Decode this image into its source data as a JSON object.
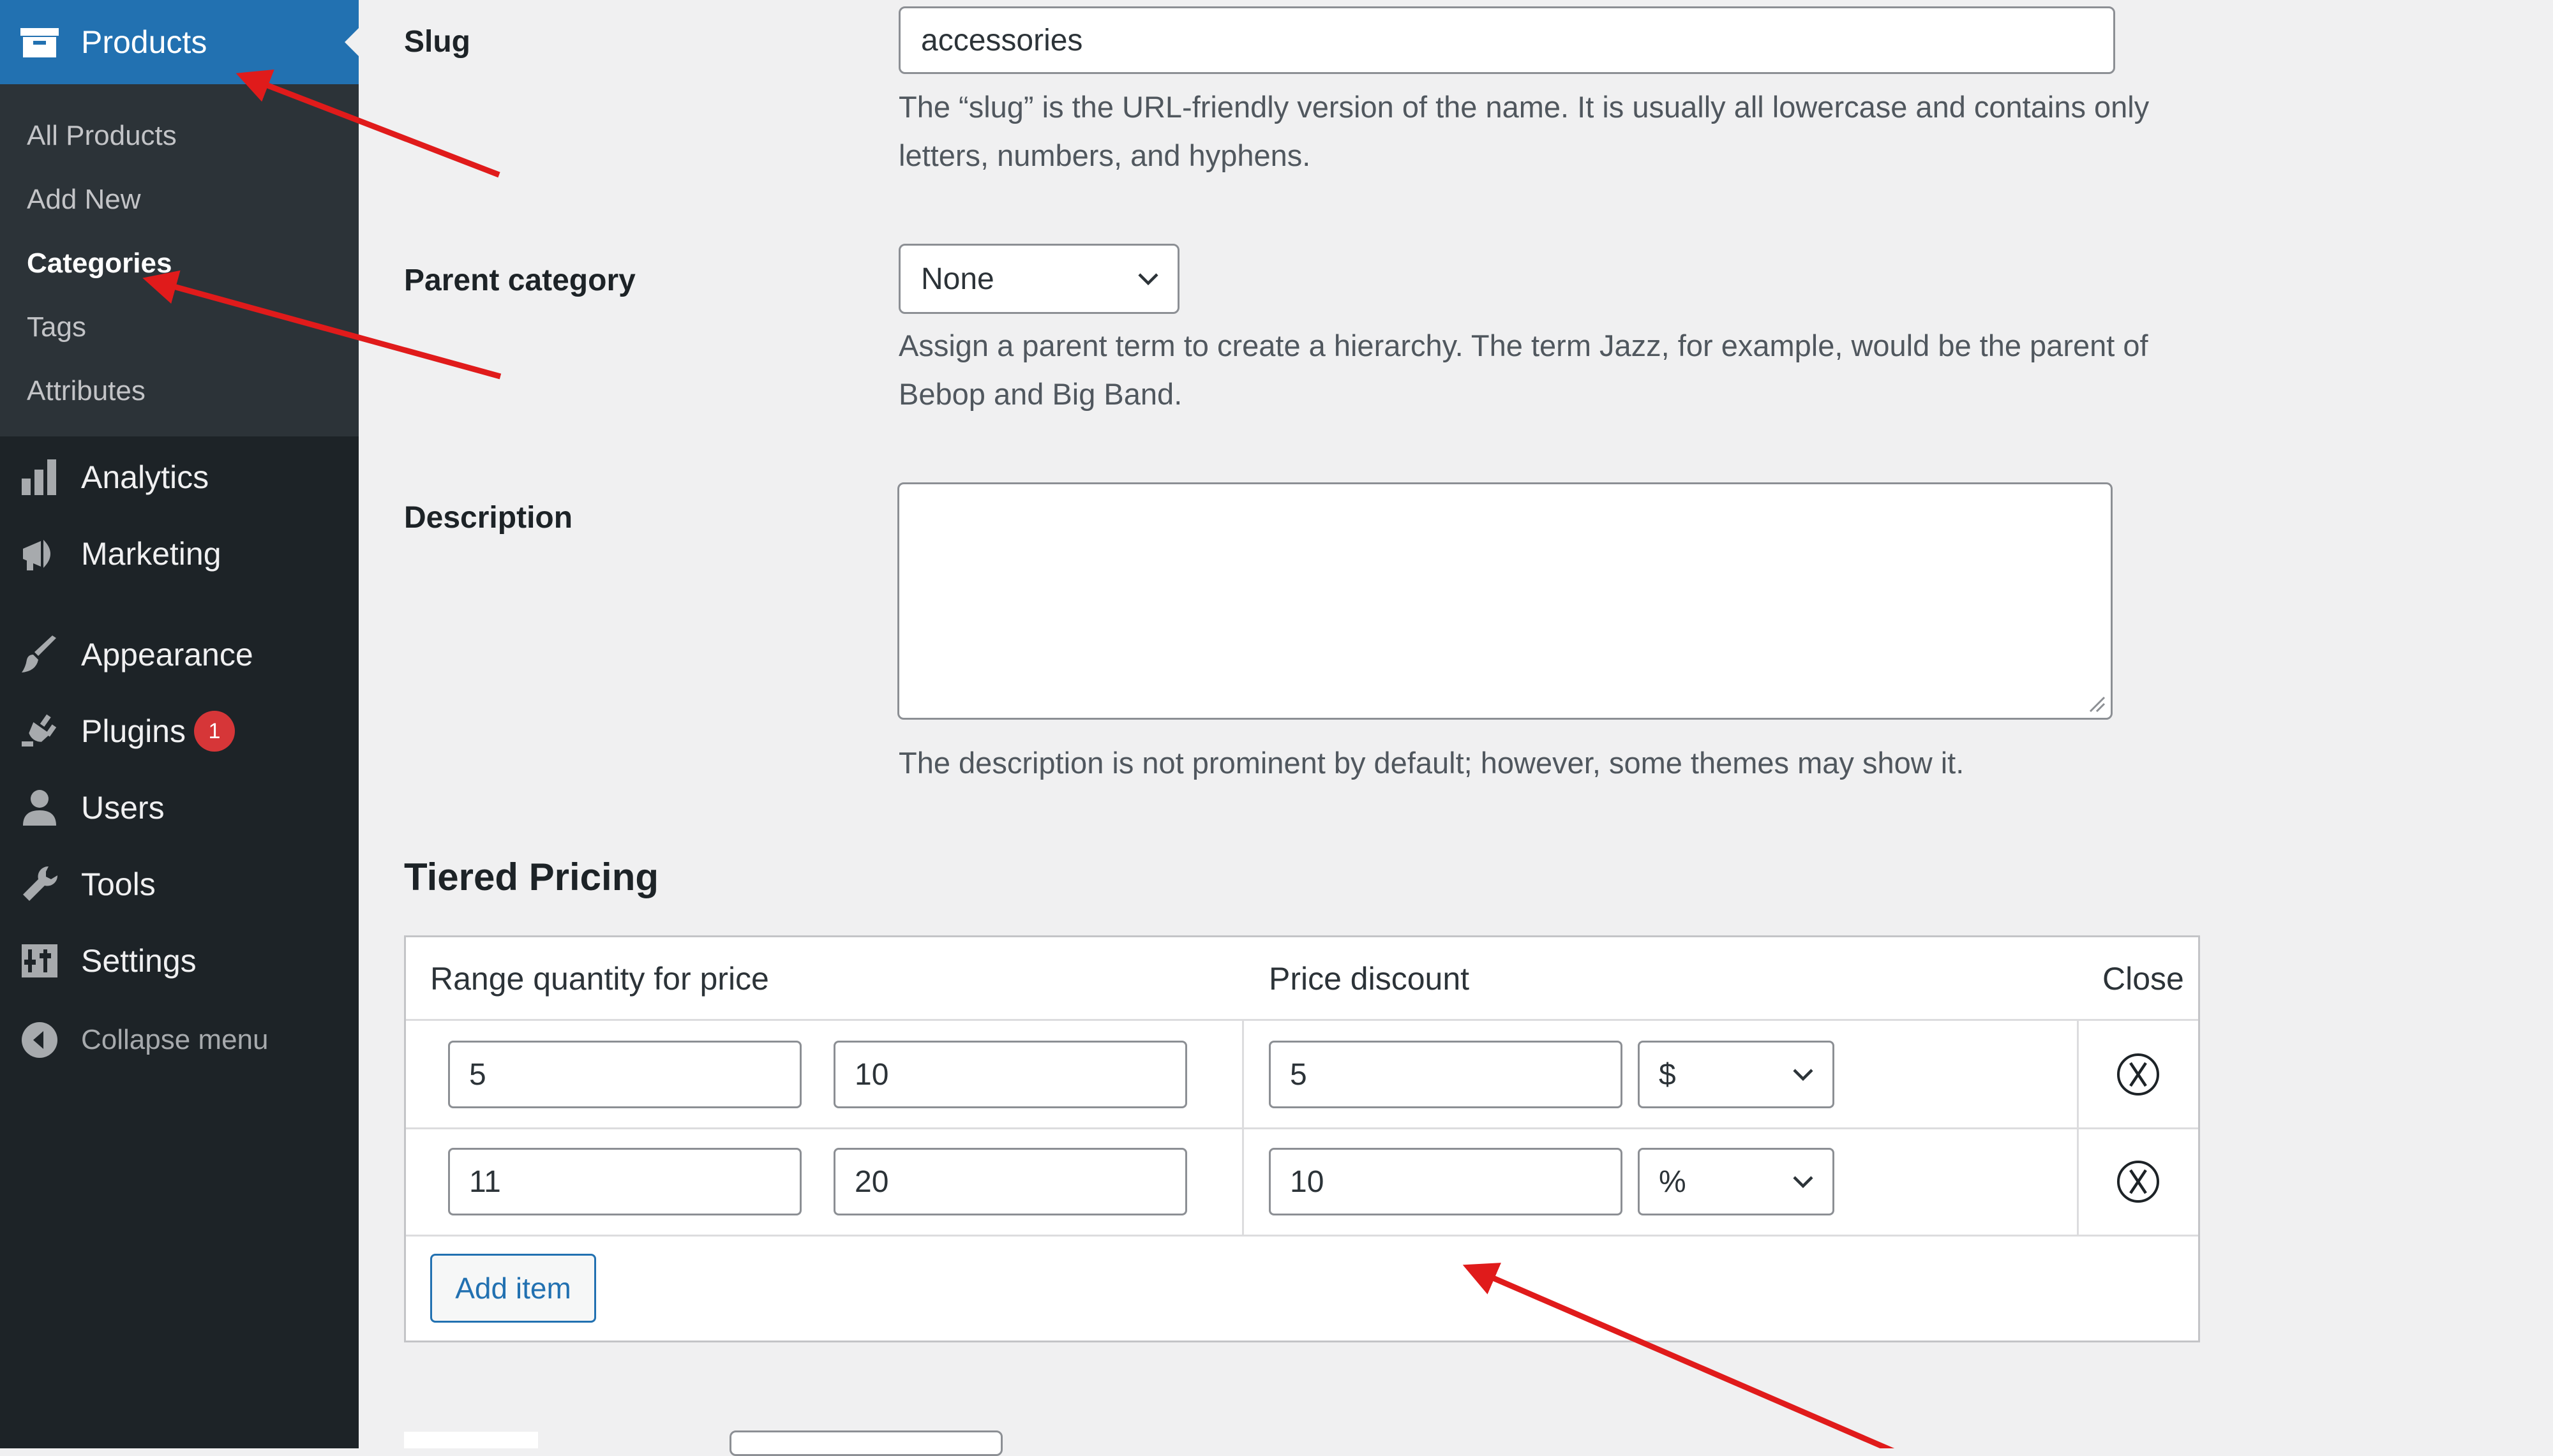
{
  "sidebar": {
    "products_label": "Products",
    "submenu": [
      "All Products",
      "Add New",
      "Categories",
      "Tags",
      "Attributes"
    ],
    "current_submenu": "Categories",
    "items": [
      {
        "label": "Analytics",
        "icon": "bar-chart-icon"
      },
      {
        "label": "Marketing",
        "icon": "megaphone-icon"
      },
      {
        "label": "Appearance",
        "icon": "paintbrush-icon"
      },
      {
        "label": "Plugins",
        "icon": "plug-icon",
        "badge": "1"
      },
      {
        "label": "Users",
        "icon": "user-icon"
      },
      {
        "label": "Tools",
        "icon": "wrench-icon"
      },
      {
        "label": "Settings",
        "icon": "settings-icon"
      }
    ],
    "collapse_label": "Collapse menu"
  },
  "form": {
    "slug_label": "Slug",
    "slug_value": "accessories",
    "slug_help": "The “slug” is the URL-friendly version of the name. It is usually all lowercase and contains only letters, numbers, and hyphens.",
    "parent_label": "Parent category",
    "parent_value": "None",
    "parent_help": "Assign a parent term to create a hierarchy. The term Jazz, for example, would be the parent of Bebop and Big Band.",
    "description_label": "Description",
    "description_value": "",
    "description_help": "The description is not prominent by default; however, some themes may show it."
  },
  "tiered_pricing": {
    "title": "Tiered Pricing",
    "headers": {
      "range": "Range quantity for price",
      "discount": "Price discount",
      "close": "Close"
    },
    "rows": [
      {
        "min": "5",
        "max": "10",
        "discount": "5",
        "type": "$"
      },
      {
        "min": "11",
        "max": "20",
        "discount": "10",
        "type": "%"
      }
    ],
    "add_item_label": "Add item"
  },
  "colors": {
    "sidebar_bg": "#1d2327",
    "submenu_bg": "#2c3338",
    "accent": "#2271b1",
    "badge": "#d63638",
    "annotation_arrow": "#e01b1b",
    "page_bg": "#f0f0f1"
  }
}
